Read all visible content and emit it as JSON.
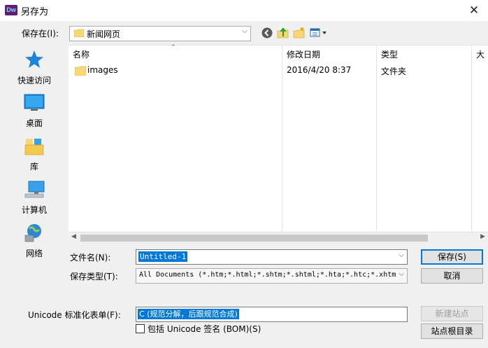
{
  "window": {
    "app_icon_text": "Dw",
    "title": "另存为",
    "close_glyph": "✕"
  },
  "location": {
    "label": "保存在(I):",
    "current": "新闻网页"
  },
  "toolbar": {
    "icons": [
      "back-icon",
      "up-folder-icon",
      "new-folder-icon",
      "view-menu-icon"
    ]
  },
  "places": [
    {
      "label": "快速访问",
      "icon": "quick-access-star-icon"
    },
    {
      "label": "桌面",
      "icon": "desktop-icon"
    },
    {
      "label": "库",
      "icon": "library-icon"
    },
    {
      "label": "计算机",
      "icon": "computer-icon"
    },
    {
      "label": "网络",
      "icon": "network-icon"
    }
  ],
  "file_list": {
    "columns": [
      "名称",
      "修改日期",
      "类型",
      "大"
    ],
    "rows": [
      {
        "name": "images",
        "modified": "2016/4/20 8:37",
        "type": "文件夹"
      }
    ]
  },
  "form": {
    "filename_label": "文件名(N):",
    "filename_value": "Untitled-1",
    "filetype_label": "保存类型(T):",
    "filetype_value": "All Documents (*.htm;*.html;*.shtm;*.shtml;*.hta;*.htc;*.xhtm",
    "unicode_label": "Unicode 标准化表单(F):",
    "unicode_value": "C (规范分解，后跟规范合成)",
    "bom_label": "包括 Unicode 签名 (BOM)(S)"
  },
  "buttons": {
    "save": "保存(S)",
    "cancel": "取消",
    "new_site": "新建站点",
    "site_root": "站点根目录"
  },
  "colors": {
    "selection": "#0078d7",
    "folder": "#f8d775"
  }
}
